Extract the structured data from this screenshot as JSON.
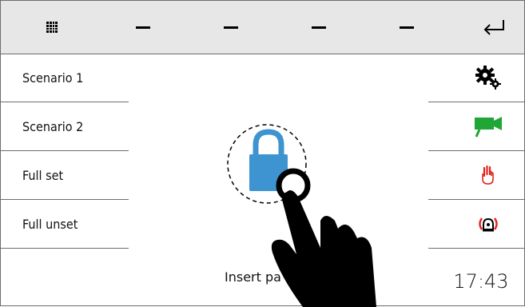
{
  "topbar": {
    "grid_icon": "grid-icon",
    "back_icon": "enter-arrow-icon",
    "dashes": [
      "–",
      "–",
      "–",
      "–"
    ]
  },
  "menu": [
    {
      "label": "Scenario 1"
    },
    {
      "label": "Scenario 2"
    },
    {
      "label": "Full set"
    },
    {
      "label": "Full unset"
    }
  ],
  "right_panel": {
    "icons": [
      "gears-icon",
      "camera-icon",
      "hand-icon",
      "alarm-icon"
    ],
    "colors": {
      "camera": "#1fa637",
      "alarm": "#e2241b"
    }
  },
  "lock": {
    "color": "#3d94d0"
  },
  "insert_text": "Insert pa",
  "time": "17:43"
}
